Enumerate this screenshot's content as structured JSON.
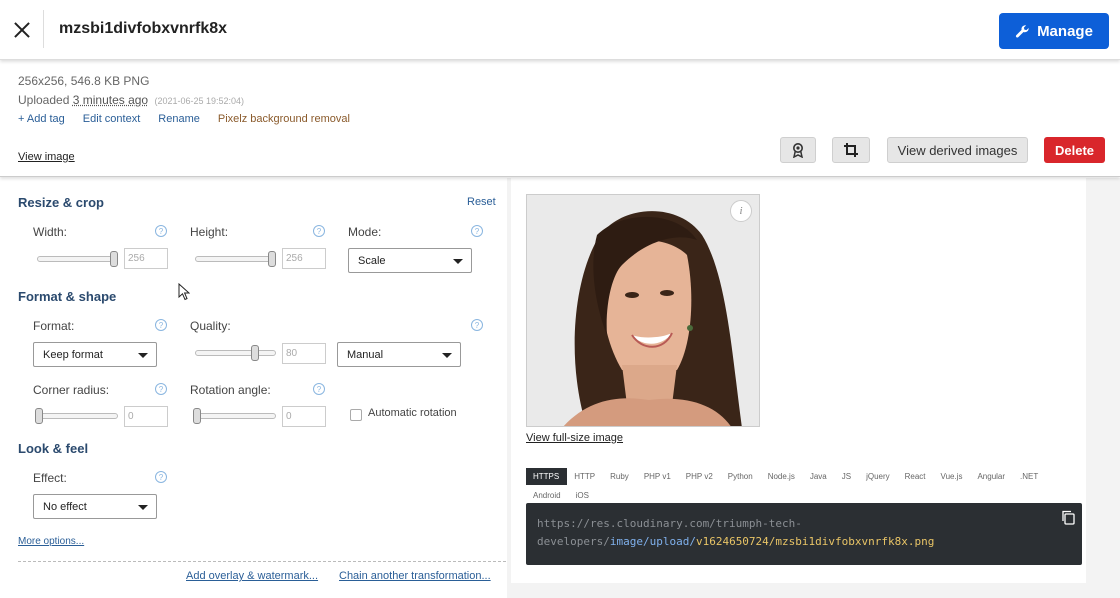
{
  "header": {
    "title": "mzsbi1divfobxvnrfk8x",
    "manage_label": "Manage"
  },
  "info": {
    "meta": "256x256, 546.8 KB PNG",
    "uploaded_prefix": "Uploaded",
    "uploaded_ago": "3 minutes ago",
    "uploaded_stamp": "(2021-06-25 19:52:04)",
    "actions": [
      "+ Add tag",
      "Edit context",
      "Rename",
      "Pixelz background removal"
    ],
    "view_image": "View image",
    "view_derived": "View derived images",
    "delete": "Delete"
  },
  "editor": {
    "resize_title": "Resize & crop",
    "reset": "Reset",
    "width_label": "Width:",
    "width_value": "256",
    "height_label": "Height:",
    "height_value": "256",
    "mode_label": "Mode:",
    "mode_value": "Scale",
    "format_title": "Format & shape",
    "format_label": "Format:",
    "format_value": "Keep format",
    "quality_label": "Quality:",
    "quality_value": "80",
    "quality_mode": "Manual",
    "radius_label": "Corner radius:",
    "radius_value": "0",
    "rotation_label": "Rotation angle:",
    "rotation_value": "0",
    "auto_rotation": "Automatic rotation",
    "look_title": "Look & feel",
    "effect_label": "Effect:",
    "effect_value": "No effect",
    "more_options": "More options...",
    "add_overlay": "Add overlay & watermark...",
    "chain": "Chain another transformation..."
  },
  "preview": {
    "info_glyph": "i",
    "full_size": "View full-size image",
    "sdk_tabs": [
      "HTTPS",
      "HTTP",
      "Ruby",
      "PHP v1",
      "PHP v2",
      "Python",
      "Node.js",
      "Java",
      "JS",
      "jQuery",
      "React",
      "Vue.js",
      "Angular",
      ".NET",
      "Android",
      "iOS"
    ],
    "url_prefix_1": "https://res.cloudinary.com/triumph-tech-",
    "url_prefix_2": "developers/",
    "url_path": "image/upload/",
    "url_file": "v1624650724/mzsbi1divfobxvnrfk8x.png"
  },
  "colors": {
    "accent": "#0d5fd8",
    "danger": "#d9262b",
    "link": "#2a5e97",
    "section": "#2b4a6e"
  },
  "icons": [
    "close-icon",
    "wrench-icon",
    "award-icon",
    "crop-icon",
    "help-icon",
    "caret-down-icon",
    "info-icon",
    "copy-icon"
  ]
}
